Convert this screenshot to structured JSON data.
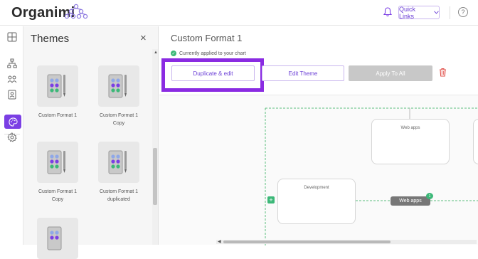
{
  "header": {
    "logo_text": "Organimi",
    "quick_links_label": "Quick Links",
    "help_symbol": "?"
  },
  "rail": {
    "icons": [
      "grid-icon",
      "org-chart-icon",
      "people-icon",
      "contact-card-icon",
      "palette-icon",
      "gear-icon"
    ],
    "active": "palette-icon"
  },
  "themes_panel": {
    "title": "Themes",
    "close_symbol": "×",
    "tiles": [
      {
        "label_line1": "Custom Format 1",
        "label_line2": ""
      },
      {
        "label_line1": "Custom Format 1",
        "label_line2": "Copy"
      },
      {
        "label_line1": "Custom Format 1",
        "label_line2": "Copy"
      },
      {
        "label_line1": "Custom Format 1",
        "label_line2": "duplicated"
      },
      {
        "label_line1": "",
        "label_line2": ""
      }
    ]
  },
  "main": {
    "title": "Custom Format 1",
    "applied_text": "Currently applied to your chart",
    "buttons": {
      "duplicate": "Duplicate & edit",
      "edit": "Edit Theme",
      "apply": "Apply To All"
    }
  },
  "canvas": {
    "nodes": [
      {
        "label": "Web apps"
      },
      {
        "label": "Development"
      }
    ],
    "pill_label": "Web apps",
    "pill_badge": "1",
    "plus_symbol": "+"
  },
  "colors": {
    "accent": "#7b3fe4",
    "highlight": "#8a2be2",
    "success": "#3cb878",
    "danger": "#e0504a"
  }
}
